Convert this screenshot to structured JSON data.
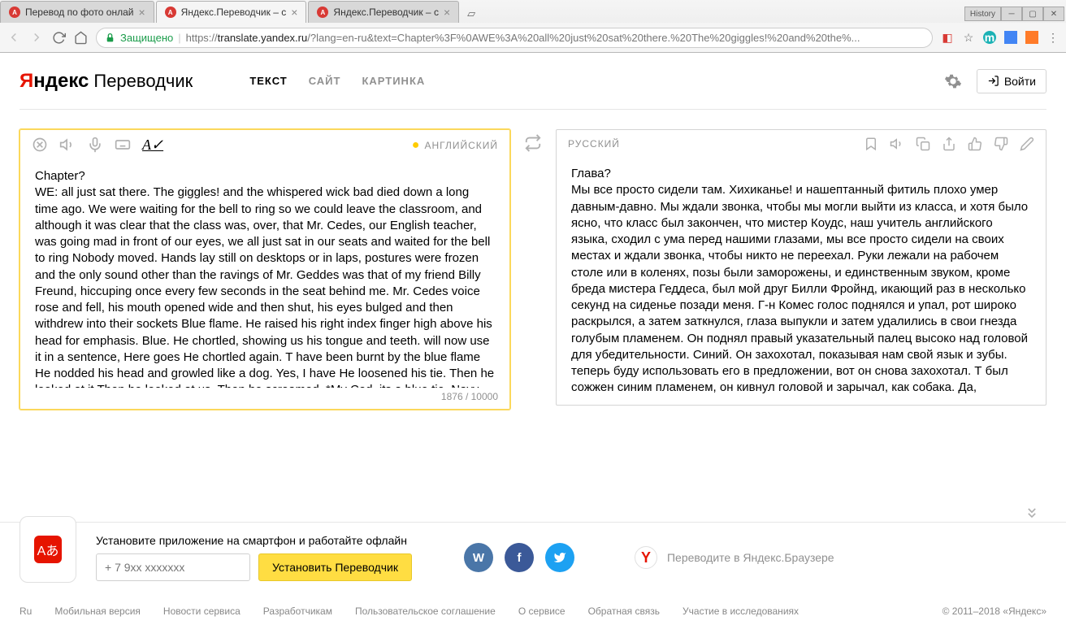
{
  "browser": {
    "tabs": [
      {
        "title": "Перевод по фото онлай",
        "active": false
      },
      {
        "title": "Яндекс.Переводчик – с",
        "active": true
      },
      {
        "title": "Яндекс.Переводчик – с",
        "active": false
      }
    ],
    "history_label": "History",
    "secure_label": "Защищено",
    "url_protocol": "https://",
    "url_host": "translate.yandex.ru",
    "url_path": "/?lang=en-ru&text=Chapter%3F%0AWE%3A%20all%20just%20sat%20there.%20The%20giggles!%20and%20the%..."
  },
  "header": {
    "logo_first": "Я",
    "logo_rest": "ндекс",
    "logo_service": "Переводчик",
    "tabs": {
      "text": "ТЕКСТ",
      "site": "САЙТ",
      "image": "КАРТИНКА"
    },
    "login": "Войти"
  },
  "source": {
    "lang": "АНГЛИЙСКИЙ",
    "text": "Chapter?\nWE: all just sat there. The giggles! and the whispered wick bad died down a long time ago. We were waiting for the bell to ring so we could leave the classroom, and although it was clear that the class was, over, that Mr. Cedes, our English teacher, was going mad in front of our eyes, we all just sat in our seats and waited for the bell to ring Nobody moved. Hands lay still on desktops or in laps, postures were frozen and the only sound other than the ravings of Mr. Geddes was that of my friend Billy Freund, hiccuping once every few seconds in the seat behind me. Mr. Cedes voice rose and fell, his mouth opened wide and then shut, his eyes bulged and then withdrew into their sockets Blue flame. He raised his right index finger high above his head for emphasis. Blue. He chortled, showing us his tongue and teeth. will now use it in a sentence, Here goes He chortled again. T have been burnt by the blue flame He nodded his head and growled like a dog. Yes, I have He loosened his tie. Then he looked at it Then he looked at us. Then he screamed. *My Cod, its a blue tie. Navy- blue.",
    "counter": "1876 / 10000"
  },
  "target": {
    "lang": "РУССКИЙ",
    "text": "Глава?\nМы все просто сидели там. Хихиканье! и нашептанный фитиль плохо умер давным-давно. Мы ждали звонка, чтобы мы могли выйти из класса, и хотя было ясно, что класс был закончен, что мистер Коудс, наш учитель английского языка, сходил с ума перед нашими глазами, мы все просто сидели на своих местах и ждали звонка, чтобы никто не переехал. Руки лежали на рабочем столе или в коленях, позы были заморожены, и единственным звуком, кроме бреда мистера Геддеса, был мой друг Билли Фройнд, икающий раз в несколько секунд на сиденье позади меня. Г-н Комес голос поднялся и упал, рот широко раскрылся, а затем заткнулся, глаза выпукли и затем удалились в свои гнезда голубым пламенем. Он поднял правый указательный палец высоко над головой для убедительности. Синий. Он захохотал, показывая нам свой язык и зубы. теперь буду использовать его в предложении, вот он снова захохотал. Т был сожжен синим пламенем, он кивнул головой и зарычал, как собака. Да,"
  },
  "promo": {
    "title": "Установите приложение на смартфон и работайте офлайн",
    "phone_placeholder": "+ 7 9xx xxxxxxx",
    "install": "Установить Переводчик",
    "browser_promo": "Переводите в Яндекс.Браузере"
  },
  "footer": {
    "lang": "Ru",
    "links": [
      "Мобильная версия",
      "Новости сервиса",
      "Разработчикам",
      "Пользовательское соглашение",
      "О сервисе",
      "Обратная связь",
      "Участие в исследованиях"
    ],
    "copyright": "© 2011–2018 «Яндекс»"
  }
}
